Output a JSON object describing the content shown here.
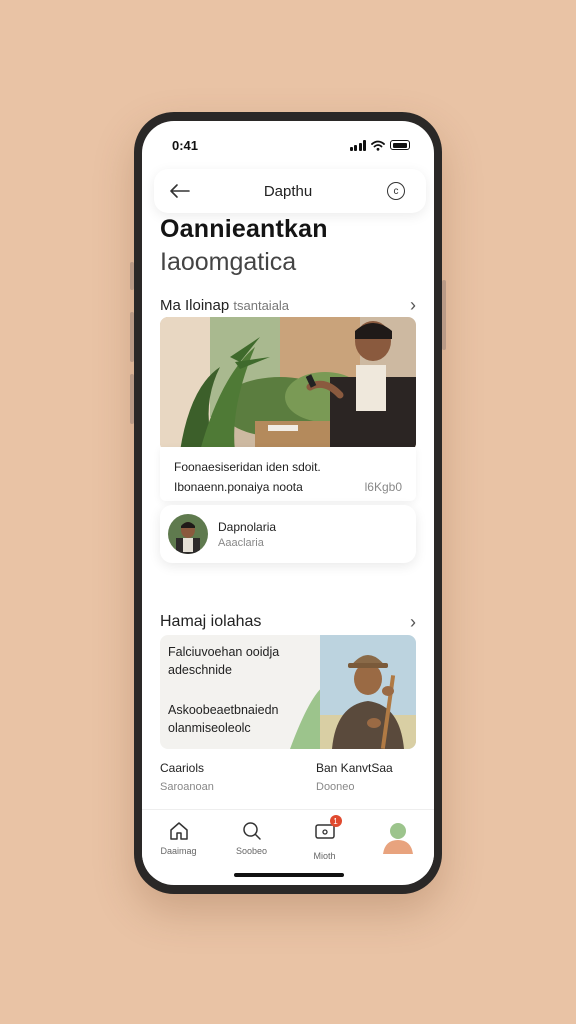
{
  "status": {
    "time": "0:41"
  },
  "topbar": {
    "title": "Dapthu"
  },
  "header": {
    "title": "Oannieantkan",
    "subtitle": "Iaoomgatica"
  },
  "section1": {
    "title": "Ma Iloinap",
    "title_muted": "tsantaiala"
  },
  "card1": {
    "line1": "Foonaesiseridan iden sdoit.",
    "line2": "Ibonaenn.ponaiya noota",
    "line2_right": "l6Kgb0",
    "profile_name": "Dapnolaria",
    "profile_sub": "Aaaclaria"
  },
  "section2": {
    "title": "Hamaj iolahas"
  },
  "card2": {
    "line1": "Falciuvoehan ooidja",
    "line2": "adeschnide",
    "line3": "Askoobeaetbnaiedn",
    "line4": "olanmiseoleolc"
  },
  "bottom": {
    "left_title": "Caariols",
    "left_sub": "Saroanoan",
    "right_title": "Ban KanvtSaa",
    "right_sub": "Dooneo"
  },
  "tabs": [
    {
      "label": "Daaimag",
      "icon": "home-icon"
    },
    {
      "label": "Soobeo",
      "icon": "search-icon"
    },
    {
      "label": "Mioth",
      "icon": "inbox-icon",
      "badge": "1"
    },
    {
      "label": "",
      "icon": "profile-avatar"
    }
  ],
  "colors": {
    "background": "#e9c3a5",
    "badge": "#e04a2f",
    "accent_green": "#9cc48c"
  }
}
